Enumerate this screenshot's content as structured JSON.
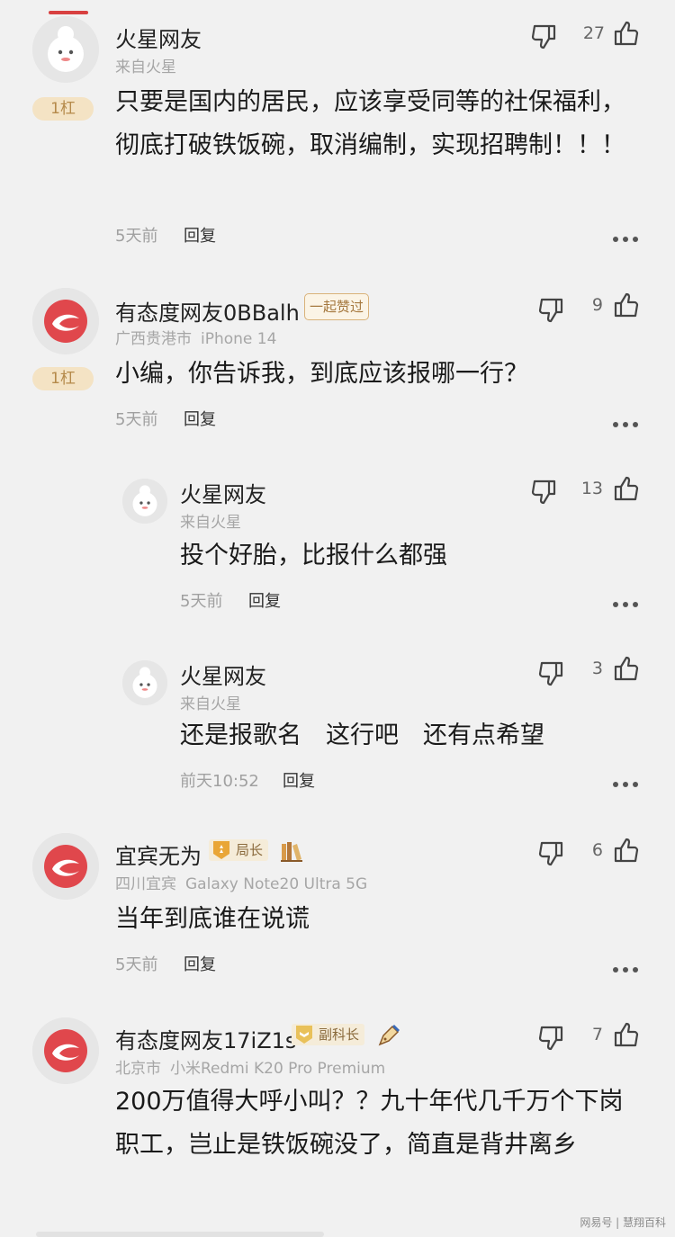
{
  "comments": [
    {
      "user": "火星网友",
      "meta": [
        "来自火星"
      ],
      "rank": "1杠",
      "content": "只要是国内的居民，应该享受同等的社保福利，彻底打破铁饭碗，取消编制，实现招聘制！！！",
      "time": "5天前",
      "reply": "回复",
      "likes": "27",
      "avatar": "ghost-avatar"
    },
    {
      "user": "有态度网友0BBalh",
      "badge": "一起赞过",
      "meta": [
        "广西贵港市",
        "iPhone 14"
      ],
      "rank": "1杠",
      "content": "小编，你告诉我，到底应该报哪一行？",
      "time": "5天前",
      "reply": "回复",
      "likes": "9",
      "avatar": "netease-avatar"
    },
    {
      "user": "火星网友",
      "meta": [
        "来自火星"
      ],
      "content": "投个好胎，比报什么都强",
      "time": "5天前",
      "reply": "回复",
      "likes": "13",
      "avatar": "ghost-avatar"
    },
    {
      "user": "火星网友",
      "meta": [
        "来自火星"
      ],
      "content": "还是报歌名　这行吧　还有点希望",
      "time": "前天10:52",
      "reply": "回复",
      "likes": "3",
      "avatar": "ghost-avatar"
    },
    {
      "user": "宜宾无为",
      "title": "局长",
      "meta": [
        "四川宜宾",
        "Galaxy Note20 Ultra 5G"
      ],
      "content": "当年到底谁在说谎",
      "time": "5天前",
      "reply": "回复",
      "likes": "6",
      "avatar": "netease-avatar"
    },
    {
      "user": "有态度网友17iZ1s",
      "title": "副科长",
      "meta": [
        "北京市",
        "小米Redmi K20 Pro Premium"
      ],
      "content": "200万值得大呼小叫？？九十年代几千万个下岗职工，岂止是铁饭碗没了，简直是背井离乡",
      "likes": "7",
      "avatar": "netease-avatar"
    }
  ],
  "watermark": "网易号 | 慧翔百科",
  "colors": {
    "background": "#f1f1f1",
    "brand_red": "#e0474c",
    "badge_gold": "#d9b27a"
  }
}
